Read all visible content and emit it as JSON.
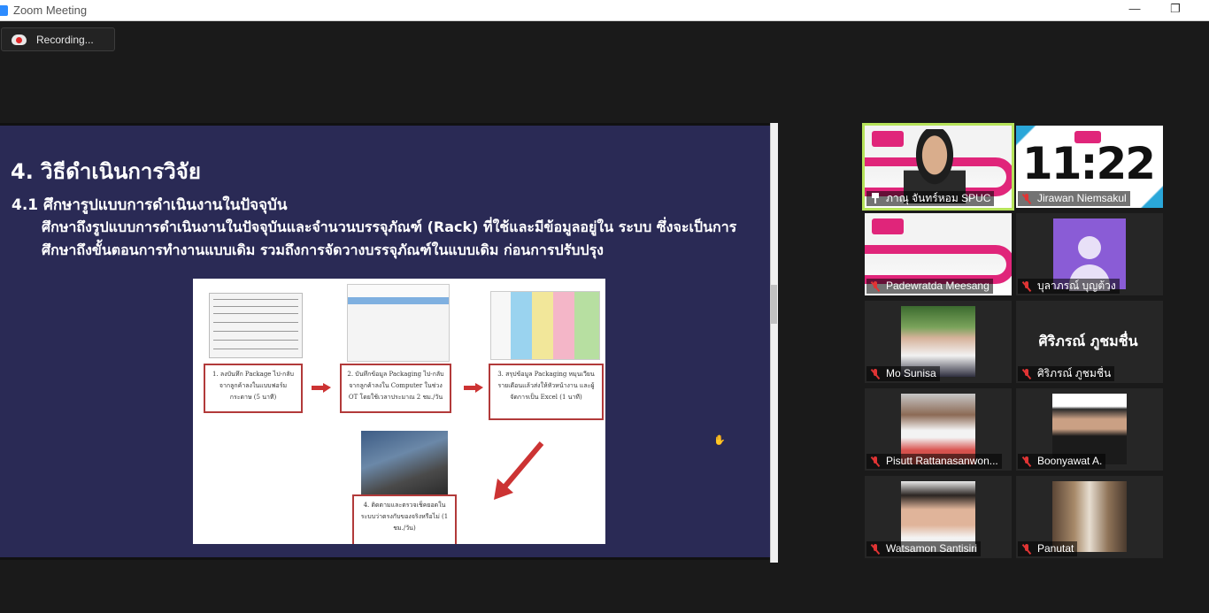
{
  "window": {
    "title": "Zoom Meeting",
    "minimize_glyph": "—",
    "restore_glyph": "❐"
  },
  "recording": {
    "label": "Recording..."
  },
  "slide": {
    "heading": "4. วิธีดำเนินการวิจัย",
    "subheading": "4.1 ศึกษารูปแบบการดำเนินงานในปัจจุบัน",
    "body": "ศึกษาถึงรูปแบบการดำเนินงานในปัจจุบันและจำนวนบรรจุภัณฑ์ (Rack) ที่ใช้และมีข้อมูลอยู่ใน ระบบ ซึ่งจะเป็นการศึกษาถึงขั้นตอนการทำงานแบบเดิม รวมถึงการจัดวางบรรจุภัณฑ์ในแบบเดิม ก่อนการปรับปรุง",
    "steps": [
      "1. ลงบันทึก Package ไป-กลับ จากลูกค้าลงในแบบฟอร์ม กระดาษ (5 นาที)",
      "2. บันทึกข้อมูล Packaging ไป-กลับ จากลูกค้าลงใน Computer ในช่วง OT โดยใช้เวลาประมาณ 2 ชม./วัน",
      "3. สรุปข้อมูล Packaging หมุนเวียน รายเดือนแล้วส่งให้หัวหน้างาน และผู้จัดการเป็น Excel (1 นาที)",
      "4. ติดตามและตรวจเช็คยอดใน ระบบว่าตรงกับของจริงหรือไม่ (1 ชม./วัน)"
    ]
  },
  "participants": [
    {
      "name": "ภาณุ จันทร์หอม SPUC",
      "pinned": true,
      "muted": false,
      "kind": "video"
    },
    {
      "name": "Jirawan Niemsakul",
      "pinned": false,
      "muted": true,
      "kind": "clock",
      "clock": "11:22"
    },
    {
      "name": "Padewratda Meesang",
      "pinned": false,
      "muted": true,
      "kind": "banner"
    },
    {
      "name": "บุลาภรณ์ บุญต้วง",
      "pinned": false,
      "muted": true,
      "kind": "placeholder"
    },
    {
      "name": "Mo Sunisa",
      "pinned": false,
      "muted": true,
      "kind": "photo"
    },
    {
      "name": "ศิริภรณ์ ภูชมชื่น",
      "pinned": false,
      "muted": true,
      "kind": "name",
      "display_name": "ศิริภรณ์ ภูชมชื่น"
    },
    {
      "name": "Pisutt Rattanasanwon...",
      "pinned": false,
      "muted": true,
      "kind": "photo"
    },
    {
      "name": "Boonyawat A.",
      "pinned": false,
      "muted": true,
      "kind": "photo"
    },
    {
      "name": "Watsamon Santisiri",
      "pinned": false,
      "muted": true,
      "kind": "photo"
    },
    {
      "name": "Panutat",
      "pinned": false,
      "muted": true,
      "kind": "photo"
    }
  ],
  "colors": {
    "active_speaker_border": "#b6e35a",
    "slide_background": "#2a2a55",
    "muted_mic": "#e03434",
    "zoom_blue": "#2d8cff"
  }
}
